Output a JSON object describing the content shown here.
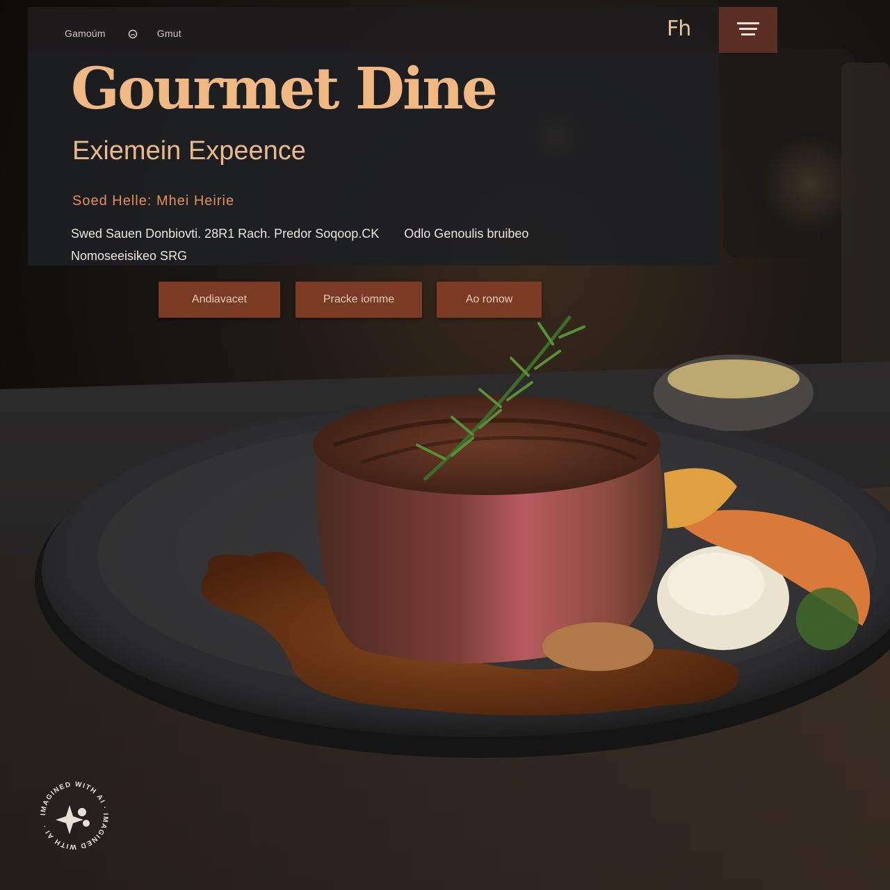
{
  "nav": {
    "link_1": "Gamoúm",
    "link_2": "Gmut",
    "brand_mark": "Fh"
  },
  "hero": {
    "title": "Gourmet Dine",
    "subtitle": "Exiemein Expeence",
    "tagline": "Soed Helle: Mhei Heirie",
    "info_line_1a": "Swed Sauen Donbiovti. 28R1 Rach. Predor Soqoop.CK",
    "info_line_1b": "Odlo Genoulis bruibeo",
    "info_line_2": "Nomoseeisikeo SRG"
  },
  "buttons": {
    "primary": "Andiavacet",
    "secondary": "Pracke iomme",
    "tertiary": "Ao ronow"
  },
  "badge": {
    "ring_text": "IMAGINED WITH AI · IMAGINED WITH AI ·"
  },
  "colors": {
    "accent_gold": "#f0b983",
    "accent_orange": "#e0905e",
    "button_rust": "#7a3a24",
    "menu_bg": "#5a2e22"
  },
  "icons": [
    "circle-icon",
    "hamburger-menu-icon",
    "sparkle-icon"
  ]
}
